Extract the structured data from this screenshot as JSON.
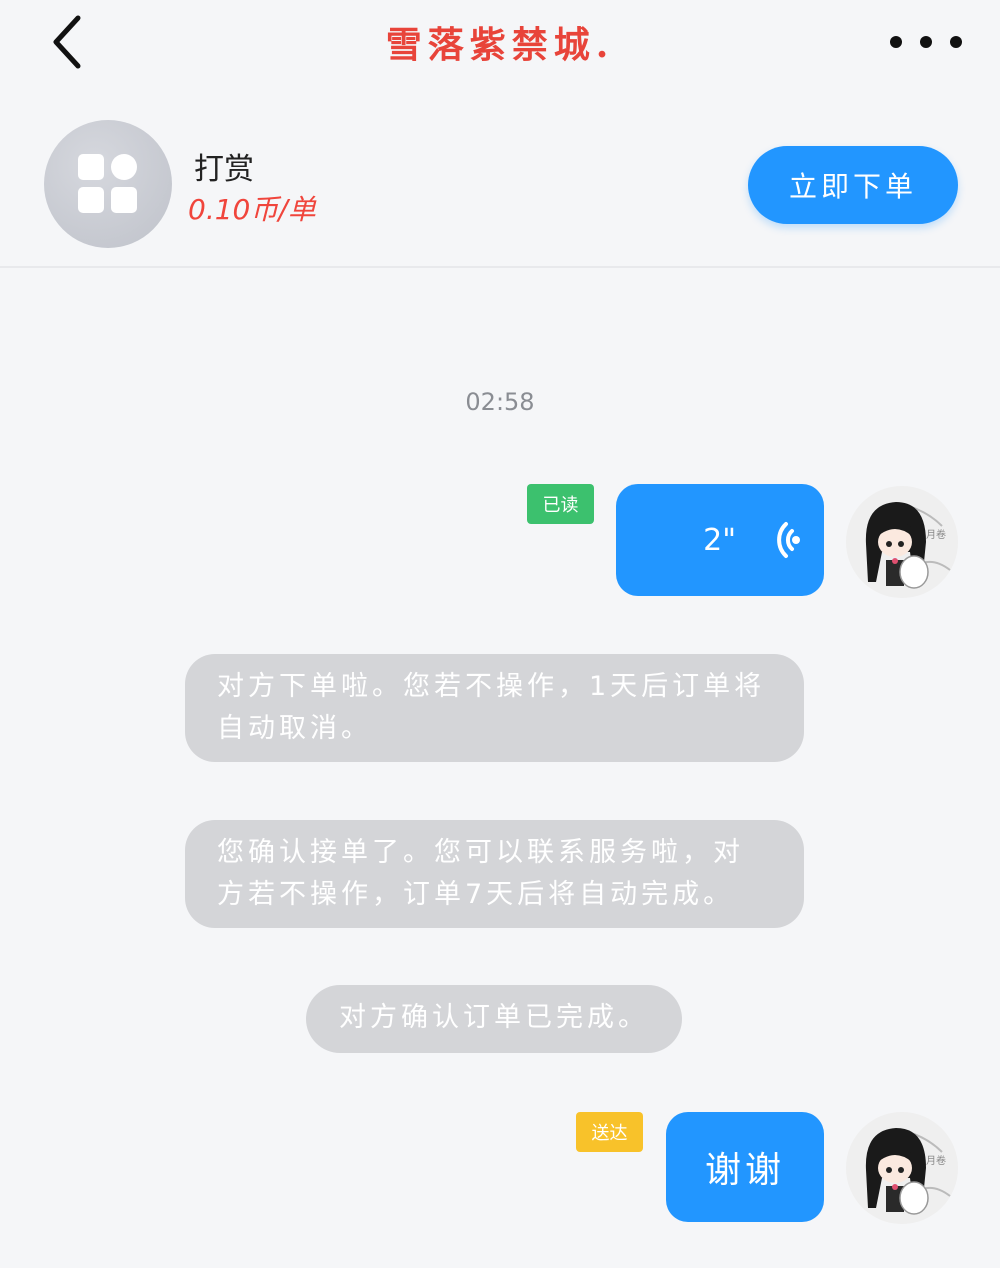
{
  "colors": {
    "title_red": "#e8443a",
    "price_red": "#f0453c",
    "accent_blue": "#2296ff",
    "read_green": "#3cc16e",
    "delivered_amber": "#f8c22a",
    "system_bubble": "#d4d5d8"
  },
  "navbar": {
    "title": "雪落紫禁城.",
    "back_icon": "chevron-left-icon",
    "more_icon": "more-horizontal-icon"
  },
  "service": {
    "icon": "apps-grid-icon",
    "name": "打赏",
    "price": "0.10币/单",
    "order_button": "立即下单"
  },
  "chat": {
    "timestamp": "02:58",
    "voice_message": {
      "duration": "2\"",
      "status": "已读",
      "icon": "voice-wave-icon"
    },
    "system_messages": [
      "对方下单啦。您若不操作，1天后订单将自动取消。",
      "您确认接单了。您可以联系服务啦，对方若不操作，订单7天后将自动完成。",
      "对方确认订单已完成。"
    ],
    "text_message": {
      "text": "谢谢",
      "status": "送达"
    }
  }
}
